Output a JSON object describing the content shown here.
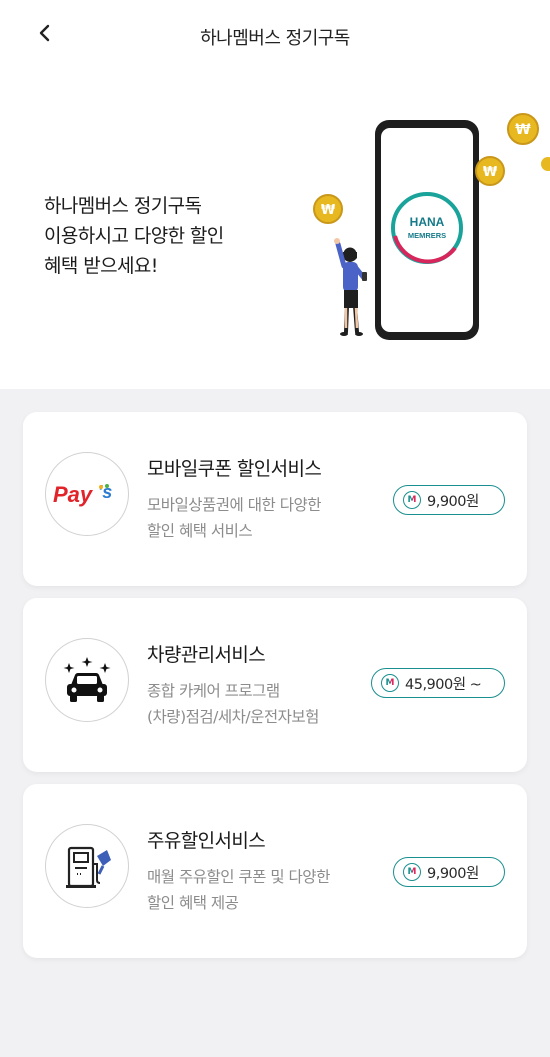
{
  "header": {
    "title": "하나멤버스 정기구독"
  },
  "hero": {
    "lines": [
      "하나멤버스 정기구독",
      "이용하시고 다양한 할인",
      "혜택 받으세요!"
    ],
    "phone_logo_line1": "HANA",
    "phone_logo_line2": "MEMRERS"
  },
  "services": [
    {
      "title": "모바일쿠폰 할인서비스",
      "desc": [
        "모바일상품권에 대한 다양한",
        "할인 혜택 서비스"
      ],
      "price": "9,900원",
      "logo_text_a": "Pay",
      "logo_text_b": "'s"
    },
    {
      "title": "차량관리서비스",
      "desc": [
        "종합 카케어 프로그램",
        "(차량)점검/세차/운전자보험"
      ],
      "price": "45,900원 ~"
    },
    {
      "title": "주유할인서비스",
      "desc": [
        "매월 주유할인 쿠폰 및 다양한",
        "할인 혜택 제공"
      ],
      "price": "9,900원"
    }
  ],
  "colors": {
    "accent": "#1a8f8f",
    "pink": "#d7265b",
    "background": "#f1f1f3",
    "coin": "#e8b820"
  },
  "badge_letter": "M"
}
